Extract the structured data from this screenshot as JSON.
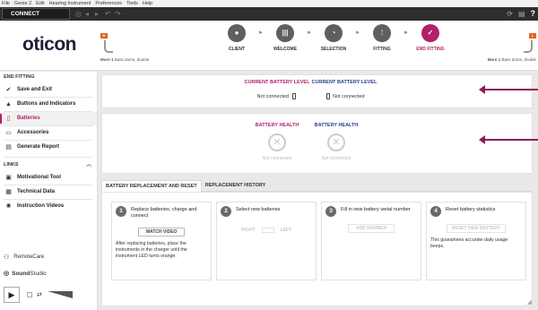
{
  "menu": [
    "File",
    "Genie 2",
    "Edit",
    "Hearing Instrument",
    "Preferences",
    "Tools",
    "Help"
  ],
  "toolbar": {
    "connect_label": "CONNECT",
    "help_label": "?"
  },
  "header": {
    "logo": "oticon",
    "left_device": {
      "badge": "R",
      "bold": "More 1",
      "text": "Bass dome, double"
    },
    "right_device": {
      "badge": "L",
      "bold": "More 1",
      "text": "Bass dome, double"
    },
    "workflow": [
      {
        "label": "CLIENT",
        "icon": "client-icon"
      },
      {
        "label": "WELCOME",
        "icon": "welcome-icon"
      },
      {
        "label": "SELECTION",
        "icon": "selection-icon"
      },
      {
        "label": "FITTING",
        "icon": "fitting-icon"
      },
      {
        "label": "END FITTING",
        "icon": "check-icon",
        "active": true
      }
    ]
  },
  "sidebar": {
    "end_fitting_title": "END FITTING",
    "items": [
      {
        "label": "Save and Exit",
        "icon": "checkmark-icon"
      },
      {
        "label": "Buttons and Indicators",
        "icon": "buttons-icon"
      },
      {
        "label": "Batteries",
        "icon": "battery-icon",
        "active": true
      },
      {
        "label": "Accessories",
        "icon": "accessories-icon"
      },
      {
        "label": "Generate Report",
        "icon": "report-icon"
      }
    ],
    "links_title": "LINKS",
    "links": [
      {
        "label": "Motivational Tool",
        "icon": "motivational-icon"
      },
      {
        "label": "Technical Data",
        "icon": "technical-icon"
      },
      {
        "label": "Instruction Videos",
        "icon": "video-icon"
      }
    ],
    "remote_label": "RemoteCare",
    "sound_studio": {
      "bold": "Sound",
      "rest": "Studio"
    }
  },
  "battery_level": {
    "right_title": "CURRENT BATTERY LEVEL",
    "left_title": "CURRENT BATTERY LEVEL",
    "right_status": "Not connected",
    "left_status": "Not connected"
  },
  "battery_health": {
    "right_title": "BATTERY HEALTH",
    "left_title": "BATTERY HEALTH",
    "right_status": "Not connected",
    "left_status": "Not connected"
  },
  "tabs": [
    "BATTERY REPLACEMENT AND RESET",
    "REPLACEMENT HISTORY"
  ],
  "steps": [
    {
      "num": "1",
      "title": "Replace batteries, charge and connect",
      "button": "WATCH VIDEO",
      "text": "After replacing batteries, place the instruments in the charger until the instrument LED turns orange."
    },
    {
      "num": "2",
      "title": "Select new batteries",
      "right": "RIGHT",
      "left": "LEFT"
    },
    {
      "num": "3",
      "title": "Fill in new battery serial number",
      "button": "ADD NUMBER"
    },
    {
      "num": "4",
      "title": "Reset battery statistics",
      "button": "RESET NEW BATTERY",
      "text": "This guarantees accurate daily usage beeps."
    }
  ],
  "colors": {
    "accent": "#b3206b",
    "blue": "#2a3f8f",
    "annotation_arrow": "#8c1a5a"
  }
}
